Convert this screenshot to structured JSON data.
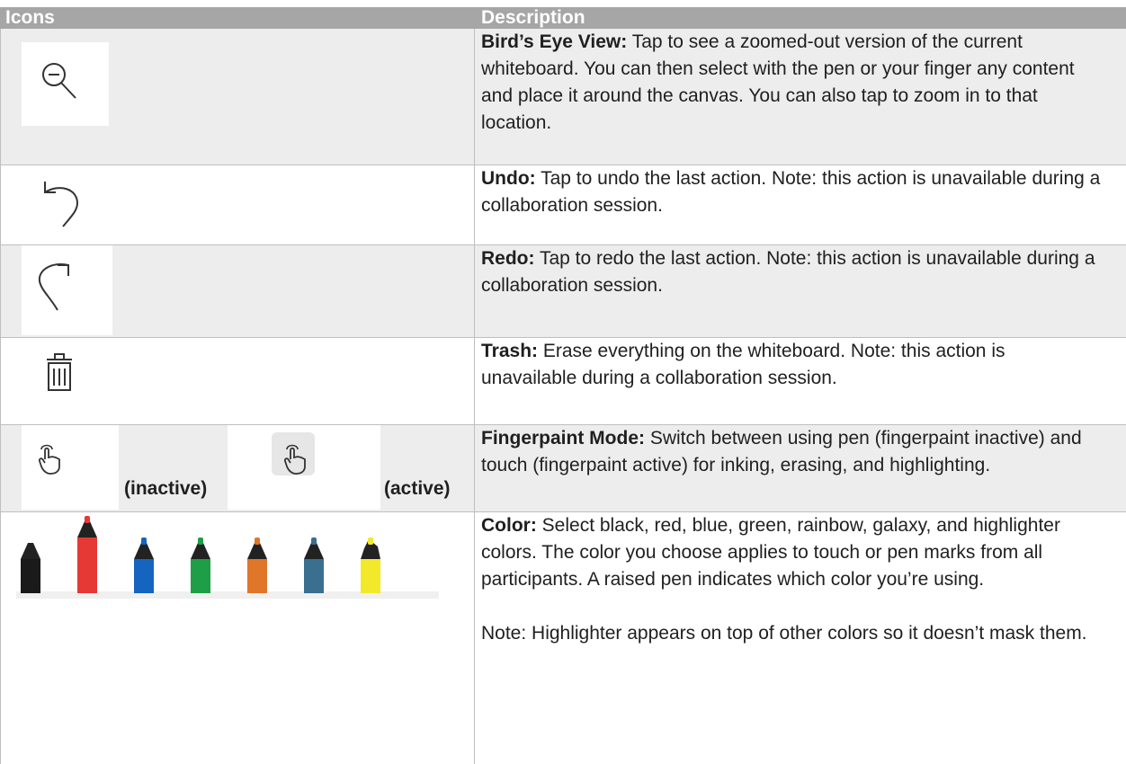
{
  "header": {
    "col_icons": "Icons",
    "col_description": "Description"
  },
  "rows": [
    {
      "term": "Bird’s Eye View:",
      "text": " Tap to see a zoomed-out version of the current whiteboard. You can then select with the pen or your finger any content and place it around the canvas. You can also tap to zoom in to that location.",
      "icon": "zoom-out-icon"
    },
    {
      "term": "Undo:",
      "text": " Tap to undo the last action. Note: this action is unavailable during a collaboration session.",
      "icon": "undo-icon"
    },
    {
      "term": "Redo:",
      "text": " Tap to redo the last action. Note: this action is unavailable during a collaboration session.",
      "icon": "redo-icon"
    },
    {
      "term": "Trash:",
      "text": " Erase everything on the whiteboard. Note: this action is unavailable during a collaboration session.",
      "icon": "trash-icon"
    },
    {
      "term": "Fingerpaint Mode:",
      "text": " Switch between using pen (fingerpaint inactive) and touch (fingerpaint active) for inking, erasing, and highlighting.",
      "icon": "fingerpaint-icon",
      "caption_inactive": "(inactive)",
      "caption_active": "(active)"
    },
    {
      "term": "Color:",
      "text": " Select black, red, blue, green, rainbow, galaxy, and highlighter colors. The color you choose applies to touch or pen marks from all participants. A raised pen indicates which color you’re using.",
      "note": "Note: Highlighter appears on top of other colors so it doesn’t mask them.",
      "pens": [
        {
          "name": "black",
          "color": "#1a1a1a",
          "raised": false
        },
        {
          "name": "red",
          "color": "#e53935",
          "raised": true
        },
        {
          "name": "blue",
          "color": "#1565c0",
          "raised": false
        },
        {
          "name": "green",
          "color": "#1e9e46",
          "raised": false
        },
        {
          "name": "rainbow",
          "color": "#e0762a",
          "raised": false
        },
        {
          "name": "galaxy",
          "color": "#3a6f8f",
          "raised": false
        },
        {
          "name": "highlighter",
          "color": "#f2e92a",
          "raised": false
        }
      ]
    }
  ]
}
